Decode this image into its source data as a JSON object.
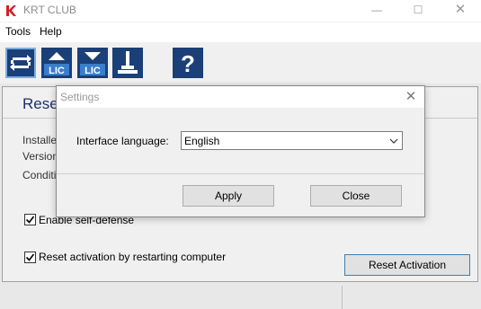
{
  "window": {
    "title": "KRT CLUB",
    "controls": {
      "minimize": "—",
      "maximize": "☐",
      "close": "✕"
    }
  },
  "menu": [
    "Tools",
    "Help"
  ],
  "toolbar": {
    "buttons": [
      {
        "icon": "reset-arrows-icon",
        "text": ""
      },
      {
        "icon": "upload-license-icon",
        "text": "LIC"
      },
      {
        "icon": "download-license-icon",
        "text": "LIC"
      },
      {
        "icon": "cleaner-brush-icon",
        "text": ""
      },
      {
        "icon": "help-icon",
        "text": "?"
      }
    ]
  },
  "main": {
    "heading": "Reset",
    "info_labels": [
      "Installe",
      "Version",
      "Conditi"
    ],
    "checkboxes": [
      {
        "label": "Enable self-defense",
        "checked": true
      },
      {
        "label": "Reset activation by restarting computer",
        "checked": true
      }
    ],
    "reset_button": "Reset Activation"
  },
  "dialog": {
    "title": "Settings",
    "close": "✕",
    "language_label": "Interface language:",
    "language_value": "English",
    "apply": "Apply",
    "close_button": "Close"
  },
  "colors": {
    "toolbar_icon_bg": "#1b3f77",
    "heading": "#1e2f6b",
    "focus_border": "#3c7fb1"
  }
}
